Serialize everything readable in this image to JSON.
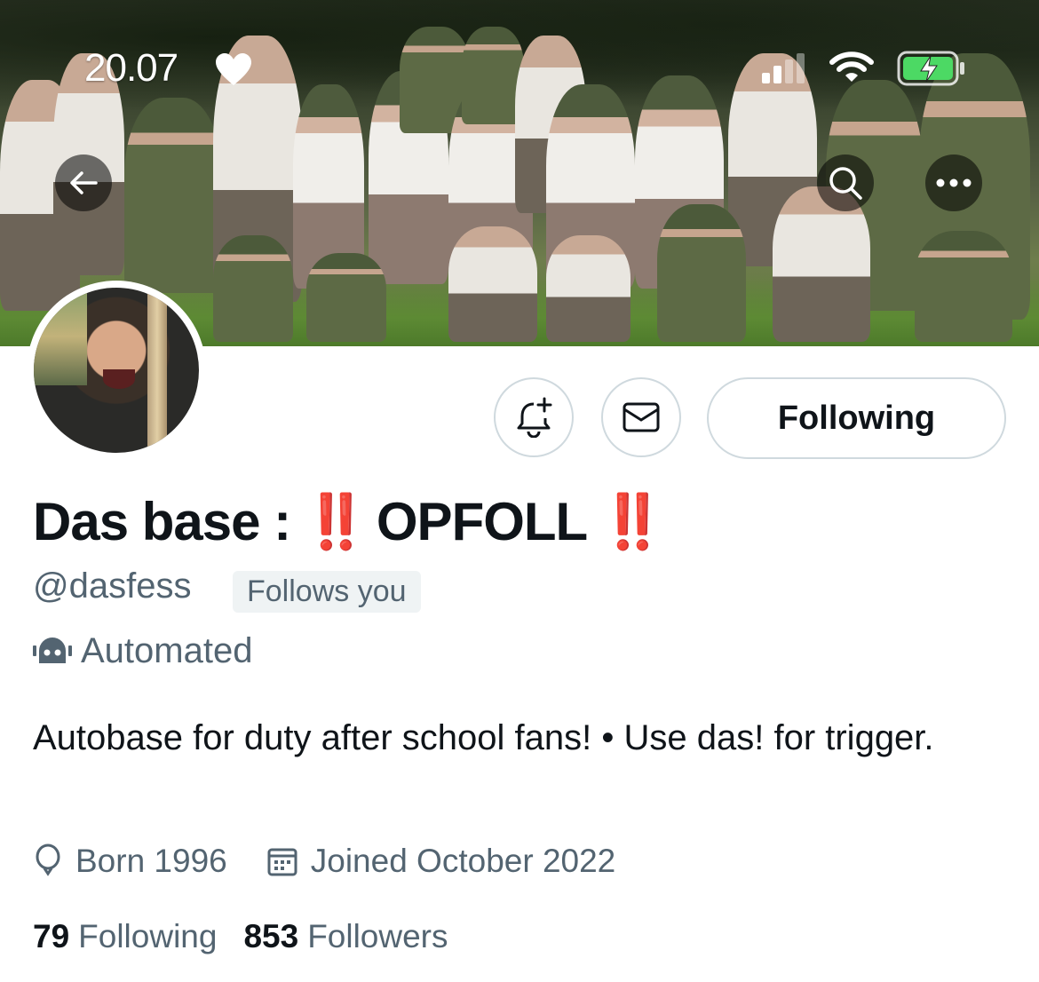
{
  "status_bar": {
    "time": "20.07"
  },
  "icons": {
    "back": "arrow-left-icon",
    "search": "search-icon",
    "more": "more-horizontal-icon",
    "notify": "bell-plus-icon",
    "message": "envelope-icon",
    "automated": "robot-icon",
    "birthday": "balloon-icon",
    "joined": "calendar-icon"
  },
  "profile": {
    "name_prefix": "Das base :",
    "name_bang": "‼️",
    "name_main": "OPFOLL",
    "handle": "@dasfess",
    "follows_you": "Follows you",
    "automated": "Automated",
    "bio": "Autobase for duty after school fans! • Use das! for trigger.",
    "born": "Born 1996",
    "joined": "Joined October 2022",
    "following_count": "79",
    "following_label": "Following",
    "followers_count": "853",
    "followers_label": "Followers"
  },
  "actions": {
    "following_button": "Following"
  },
  "colors": {
    "text_primary": "#0f1419",
    "text_secondary": "#536471",
    "border": "#cfd9de",
    "badge_bg": "#eff3f4",
    "exclamation_red": "#e0141e",
    "battery_green": "#4cd964"
  }
}
